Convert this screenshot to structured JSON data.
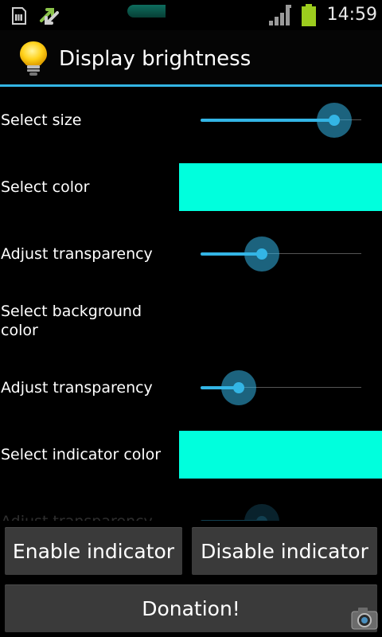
{
  "status_bar": {
    "time": "14:59",
    "icons": [
      "sim-card-icon",
      "data-transfer-icon",
      "signal-icon",
      "battery-icon"
    ],
    "battery_color": "#9ccc1e"
  },
  "app": {
    "title": "Display brightness",
    "accent_color": "#33b5e5"
  },
  "settings": {
    "size_label": "Select size",
    "size_value": 0.83,
    "color_label": "Select color",
    "color_value": "#00ffdd",
    "transparency_label_1": "Adjust transparency",
    "transparency_value_1": 0.38,
    "bg_color_label": "Select background color",
    "transparency_label_2": "Adjust transparency",
    "transparency_value_2": 0.24,
    "indicator_color_label": "Select indicator color",
    "indicator_color_value": "#00ffdd",
    "transparency_label_3": "Adjust transparency",
    "transparency_value_3": 0.38
  },
  "buttons": {
    "enable": "Enable indicator",
    "disable": "Disable indicator",
    "donate": "Donation!"
  }
}
